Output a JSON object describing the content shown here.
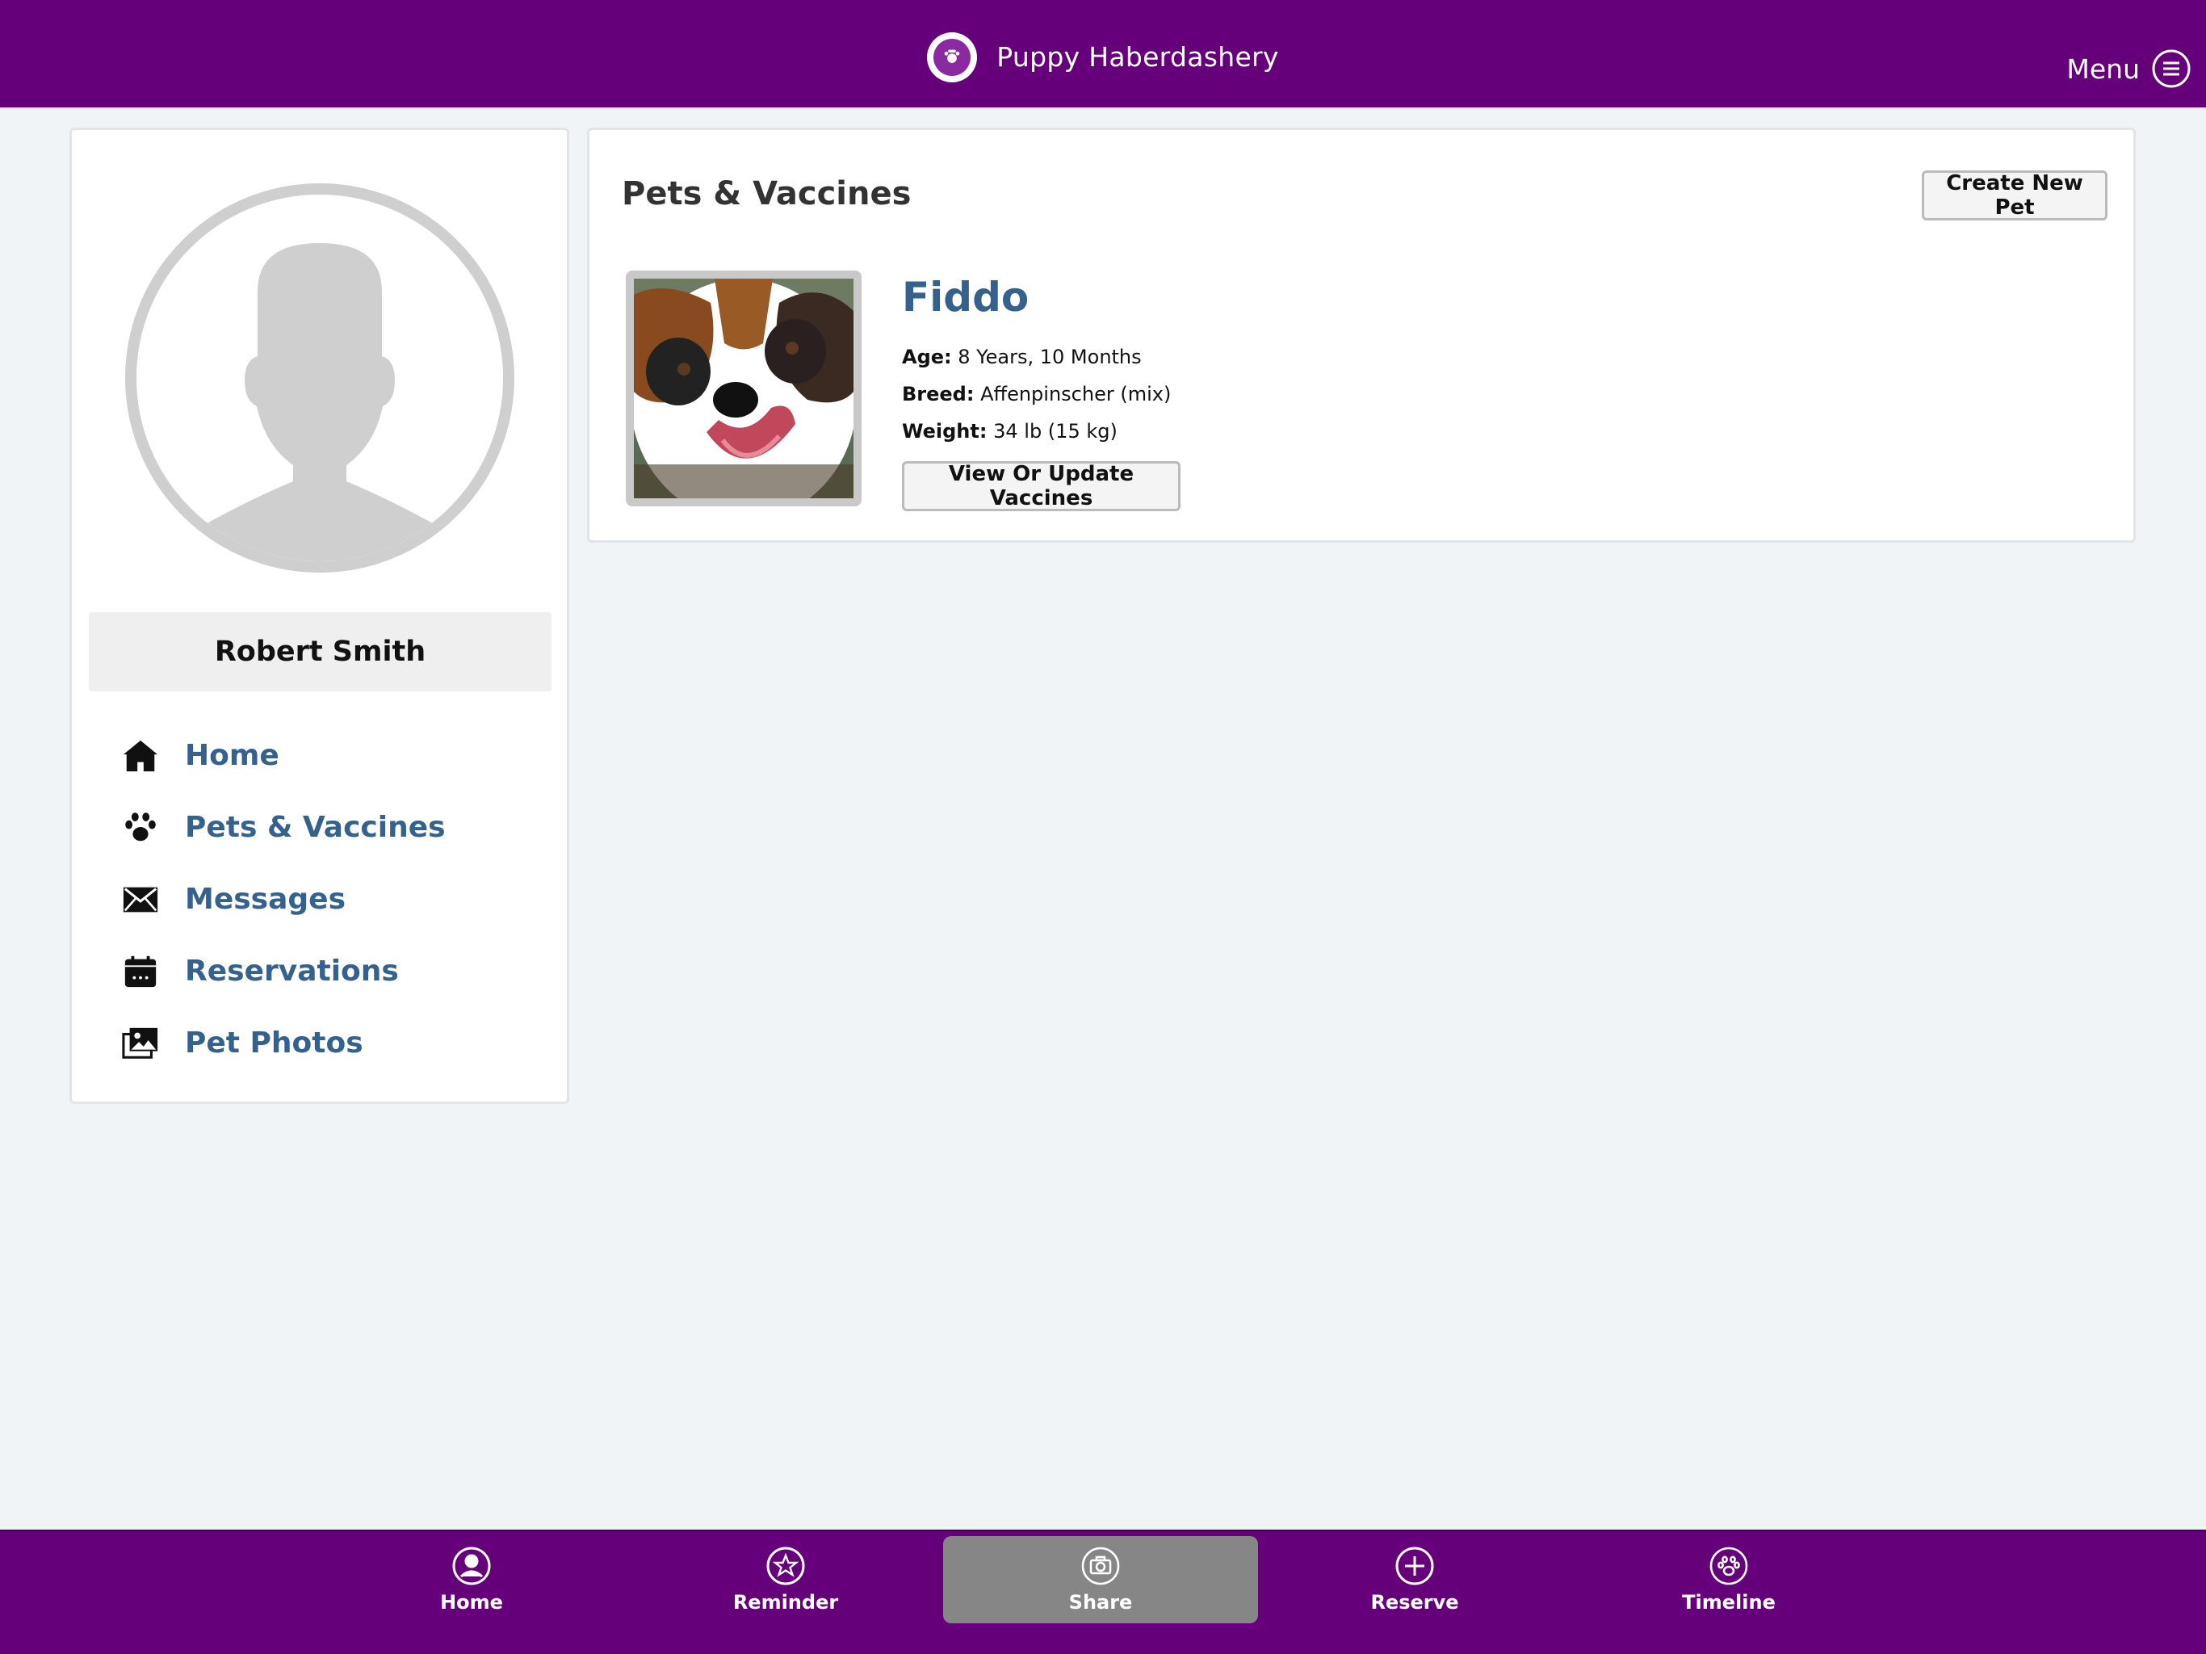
{
  "header": {
    "app_name": "Puppy Haberdashery",
    "menu_label": "Menu",
    "brand_color": "#65007a"
  },
  "sidebar": {
    "user_name": "Robert Smith",
    "items": [
      {
        "label": "Home",
        "icon": "home-icon"
      },
      {
        "label": "Pets & Vaccines",
        "icon": "paw-icon"
      },
      {
        "label": "Messages",
        "icon": "envelope-icon"
      },
      {
        "label": "Reservations",
        "icon": "calendar-icon"
      },
      {
        "label": "Pet Photos",
        "icon": "images-icon"
      }
    ]
  },
  "main": {
    "title": "Pets & Vaccines",
    "create_button": "Create New Pet",
    "pet": {
      "name": "Fiddo",
      "age_label": "Age:",
      "age": "8 Years, 10 Months",
      "breed_label": "Breed:",
      "breed": "Affenpinscher (mix)",
      "weight_label": "Weight:",
      "weight": "34 lb (15 kg)",
      "vaccines_button": "View Or Update Vaccines"
    }
  },
  "bottom_nav": {
    "tabs": [
      {
        "label": "Home",
        "icon": "user-circle-icon"
      },
      {
        "label": "Reminder",
        "icon": "star-circle-icon"
      },
      {
        "label": "Share",
        "icon": "camera-icon",
        "active": true
      },
      {
        "label": "Reserve",
        "icon": "plus-circle-icon"
      },
      {
        "label": "Timeline",
        "icon": "paw-circle-icon"
      }
    ]
  },
  "colors": {
    "link": "#35618e",
    "active_tab": "#868686"
  }
}
